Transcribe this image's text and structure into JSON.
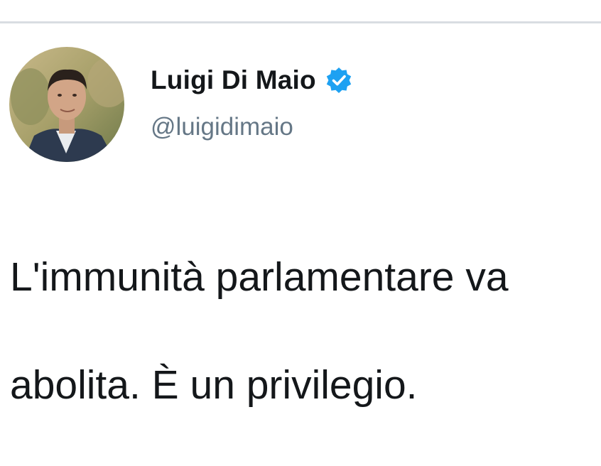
{
  "tweet": {
    "author": {
      "display_name": "Luigi Di Maio",
      "handle": "@luigidimaio",
      "verified": true,
      "avatar_icon": "profile-photo"
    },
    "text_line_1": "L'immunità parlamentare va",
    "text_line_2": "abolita. È un privilegio."
  },
  "colors": {
    "name_text": "#14171a",
    "handle_text": "#657786",
    "verified_badge": "#1da1f2",
    "divider": "#d9dde2",
    "background": "#ffffff"
  }
}
